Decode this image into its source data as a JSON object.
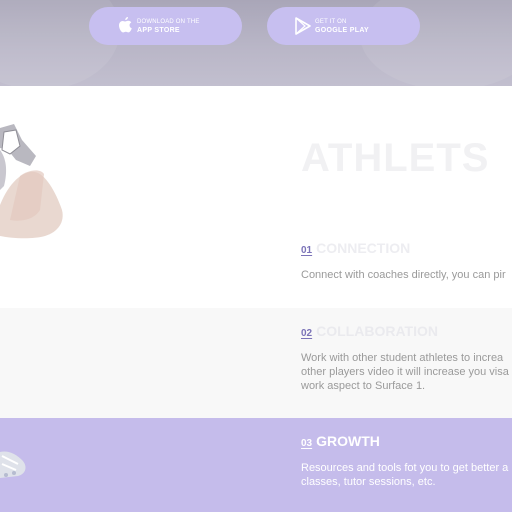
{
  "store_buttons": {
    "app_store": {
      "small": "DOWNLOAD ON THE",
      "big": "APP STORE",
      "icon": "apple-icon"
    },
    "google_play": {
      "small": "GET IT ON",
      "big": "GOOGLE PLAY",
      "icon": "play-store-icon"
    }
  },
  "section_title": "ATHLETS",
  "features": [
    {
      "num": "01",
      "title": "CONNECTION",
      "text_lines": [
        "Connect with coaches directly, you can pir"
      ]
    },
    {
      "num": "02",
      "title": "COLLABORATION",
      "text_lines": [
        "Work with other student athletes to increa",
        "other players video it will increase you visa",
        "work aspect to Surface 1."
      ]
    },
    {
      "num": "03",
      "title": "GROWTH",
      "text_lines": [
        "Resources and tools fot you to get better a",
        "classes, tutor sessions, etc."
      ]
    }
  ],
  "colors": {
    "accent": "#c5bceb",
    "hero": "#b9b6c7",
    "button": "#c7bff0"
  }
}
